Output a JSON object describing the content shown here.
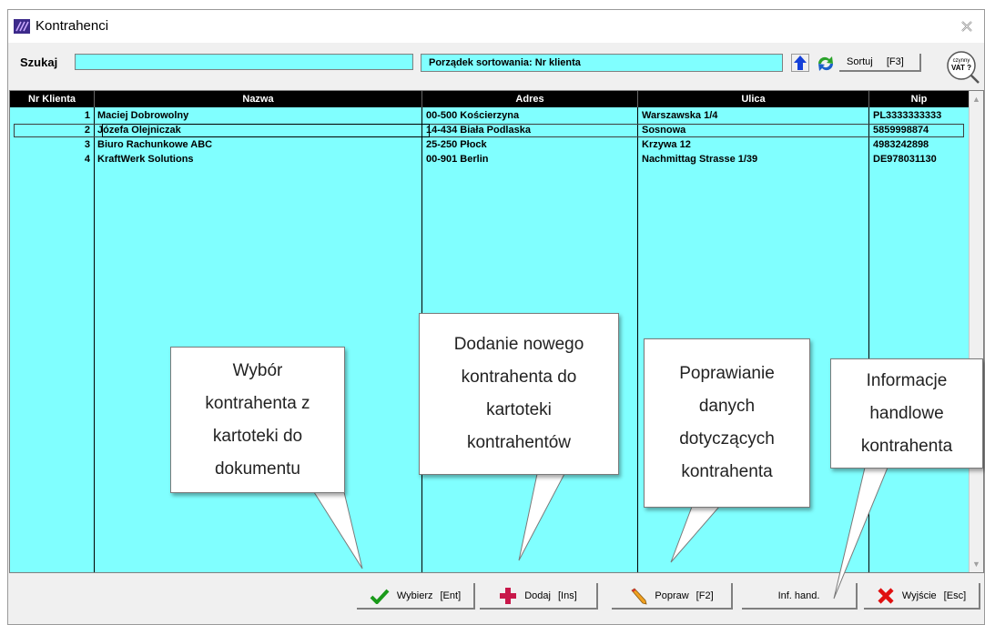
{
  "window": {
    "title": "Kontrahenci"
  },
  "search": {
    "label": "Szukaj",
    "value": ""
  },
  "sort": {
    "label": "Porządek sortowania: Nr klienta",
    "button_label": "Sortuj",
    "button_shortcut": "[F3]",
    "vat_line1": "czynny",
    "vat_line2": "VAT ?"
  },
  "table": {
    "columns": [
      "Nr Klienta",
      "Nazwa",
      "Adres",
      "Ulica",
      "Nip"
    ],
    "rows": [
      [
        "1",
        "Maciej Dobrowolny",
        "00-500 Kościerzyna",
        "Warszawska 1/4",
        "PL3333333333"
      ],
      [
        "2",
        "Józefa Olejniczak",
        "14-434 Biała Podlaska",
        "Sosnowa",
        "5859998874"
      ],
      [
        "3",
        "Biuro Rachunkowe ABC",
        "25-250 Płock",
        "Krzywa 12",
        "4983242898"
      ],
      [
        "4",
        "KraftWerk Solutions",
        "00-901 Berlin",
        "Nachmittag Strasse 1/39",
        "DE978031130"
      ]
    ],
    "selected_row": 2
  },
  "buttons": {
    "wybierz": {
      "label": "Wybierz",
      "shortcut": "[Ent]"
    },
    "dodaj": {
      "label": "Dodaj",
      "shortcut": "[Ins]"
    },
    "popraw": {
      "label": "Popraw",
      "shortcut": "[F2]"
    },
    "inf": {
      "label": "Inf. hand."
    },
    "wyjscie": {
      "label": "Wyjście",
      "shortcut": "[Esc]"
    }
  },
  "callouts": {
    "wybor": [
      "Wybór",
      "kontrahenta z",
      "kartoteki do",
      "dokumentu"
    ],
    "dodanie": [
      "Dodanie nowego",
      "kontrahenta do",
      "kartoteki",
      "kontrahentów"
    ],
    "poprawianie": [
      "Poprawianie",
      "danych",
      "dotyczących",
      "kontrahenta"
    ],
    "informacje": [
      "Informacje",
      "handlowe",
      "kontrahenta"
    ]
  },
  "colors": {
    "grid_bg": "#80ffff",
    "header_bg": "#000000",
    "brand": "#3c2a8a"
  },
  "icons": [
    "app-logo-icon",
    "close-icon",
    "sort-up-arrow-icon",
    "refresh-icon",
    "vat-check-icon",
    "checkmark-icon",
    "plus-icon",
    "pencil-icon",
    "x-icon"
  ]
}
